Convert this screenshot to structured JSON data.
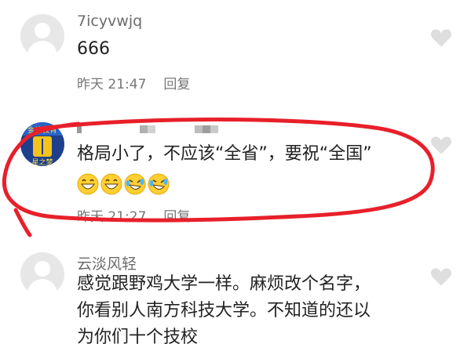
{
  "comments": [
    {
      "name": "7icyvwjq",
      "text": "666",
      "time": "昨天 21:47",
      "reply_label": "回复",
      "avatar": "default-avatar",
      "like_icon": "heart-outline-icon"
    },
    {
      "name": "",
      "text": "格局小了，不应该“全省”，要祝“全国”",
      "emojis": [
        "grin-emoji",
        "grin-emoji",
        "laugh-cry-emoji",
        "laugh-cry-emoji"
      ],
      "time": "昨天 21:27",
      "reply_label": "回复",
      "avatar": "school-logo-avatar",
      "like_icon": "heart-outline-icon"
    },
    {
      "name": "云淡风轻",
      "text_lines": [
        "感觉跟野鸡大学一样。麻烦改个名字，",
        "你看别人南方科技大学。不知道的还以",
        "为你们十个技校"
      ],
      "avatar": "default-avatar",
      "like_icon": "heart-outline-icon"
    }
  ],
  "annotation_color": "#e8202a",
  "colors": {
    "name": "#6b6b6b",
    "text": "#222222",
    "meta": "#777777",
    "heart": "#d6d6d6"
  }
}
